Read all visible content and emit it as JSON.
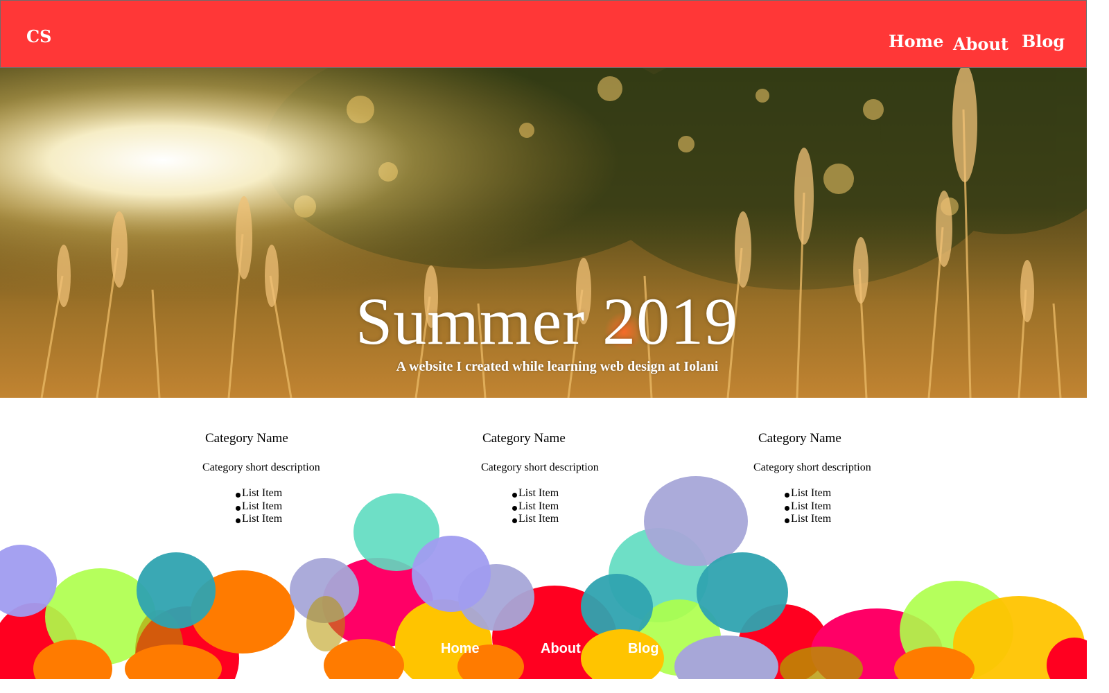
{
  "header": {
    "logo": "CS",
    "nav": [
      {
        "label": "Home"
      },
      {
        "label": "About"
      },
      {
        "label": "Blog"
      }
    ],
    "background_color": "#ff3737"
  },
  "hero": {
    "title": "Summer 2019",
    "subtitle": "A website I created while learning web design at Iolani"
  },
  "categories": [
    {
      "name": "Category Name",
      "description": "Category short description",
      "items": [
        "List Item",
        "List Item",
        "List Item"
      ]
    },
    {
      "name": "Category Name",
      "description": "Category short description",
      "items": [
        "List Item",
        "List Item",
        "List Item"
      ]
    },
    {
      "name": "Category Name",
      "description": "Category short description",
      "items": [
        "List Item",
        "List Item",
        "List Item"
      ]
    }
  ],
  "footer": {
    "nav": [
      {
        "label": "Home"
      },
      {
        "label": "About"
      },
      {
        "label": "Blog"
      }
    ]
  }
}
